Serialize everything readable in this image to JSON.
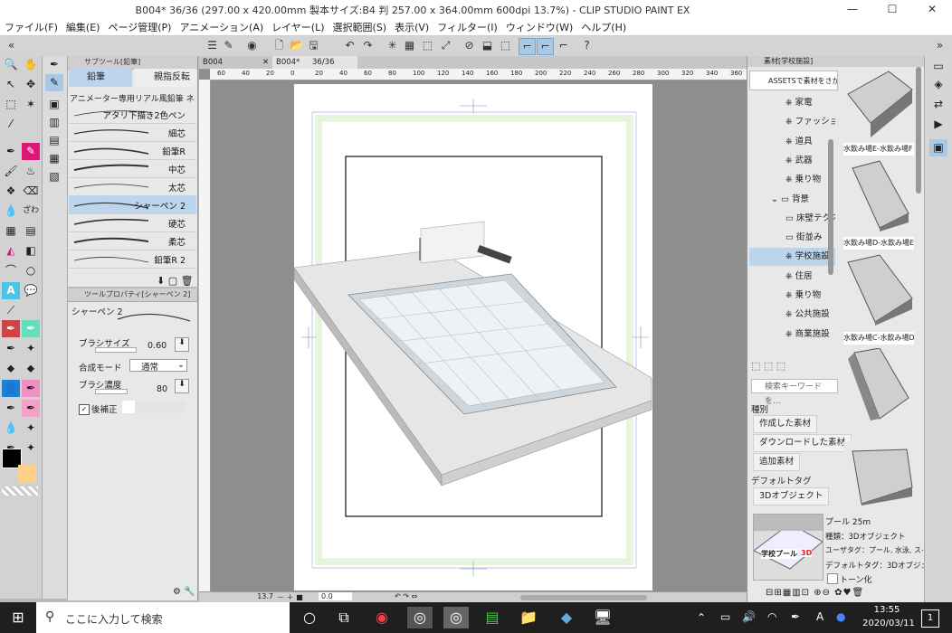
{
  "window": {
    "title": "B004* 36/36 (297.00 x 420.00mm 製本サイズ:B4 判 257.00 x 364.00mm 600dpi 13.7%) - CLIP STUDIO PAINT EX",
    "minimize": "—",
    "maximize": "☐",
    "close": "✕"
  },
  "menu": [
    "ファイル(F)",
    "編集(E)",
    "ページ管理(P)",
    "アニメーション(A)",
    "レイヤー(L)",
    "選択範囲(S)",
    "表示(V)",
    "フィルター(I)",
    "ウィンドウ(W)",
    "ヘルプ(H)"
  ],
  "subtool_panel": {
    "title": "サブツール[鉛筆]",
    "tab_pencil": "鉛筆",
    "tab_other": "親指反転",
    "group_name": "アニメーター専用リアル風鉛筆 ネ",
    "brushes": [
      "アタリ下描き2色ペン",
      "細芯",
      "鉛筆R",
      "中芯",
      "太芯",
      "シャーペン 2",
      "硬芯",
      "柔芯",
      "鉛筆R 2"
    ],
    "selected_brush": "シャーペン 2"
  },
  "tool_property": {
    "title": "ツールプロパティ[シャーペン 2]",
    "preview_name": "シャーペン 2",
    "brush_size_label": "ブラシサイズ",
    "brush_size_value": "0.60",
    "blend_mode_label": "合成モード",
    "blend_mode_value": "通常",
    "density_label": "ブラシ濃度",
    "density_value": "80",
    "stabilization_label": "後補正"
  },
  "canvas": {
    "tab_1": "B004",
    "tab_2": "B004*",
    "tab_2_page": "36/36",
    "ruler_ticks": [
      "60",
      "40",
      "20",
      "0",
      "20",
      "40",
      "60",
      "80",
      "100",
      "120",
      "140",
      "160",
      "180",
      "200",
      "220",
      "240",
      "260",
      "280",
      "300",
      "320",
      "340",
      "360"
    ],
    "zoom": "13.7",
    "angle": "0.0"
  },
  "material_panel": {
    "title": "素材[学校施設]",
    "assets_button": "ASSETSで素材をさがす",
    "tree": [
      "家電",
      "ファッション",
      "道具",
      "武器",
      "乗り物",
      "背景",
      "床壁テクスチャ",
      "街並み",
      "学校施設",
      "住居",
      "乗り物",
      "公共施設",
      "商業施設"
    ],
    "selected_tree": "学校施設",
    "search_placeholder": "検索キーワードを...",
    "filter_heading": "種別",
    "filters": [
      "作成した素材",
      "ダウンロードした素材",
      "追加素材"
    ],
    "default_tag_heading": "デフォルトタグ",
    "default_tag": "3Dオブジェクト",
    "thumb_captions": [
      "水飲み場E-水飲み場F",
      "水飲み場D-水飲み場E",
      "水飲み場C-水飲み場D"
    ],
    "detail": {
      "name": "プール 25m",
      "type": "種類：3Dオブジェクト",
      "user_tags": "ユーザタグ：プール, 水泳, スイミング",
      "default_tag": "デフォルトタグ：3Dオブジェクト",
      "tone_label": "トーン化",
      "thumb_label": "学校プール",
      "thumb_label_3d": "3D"
    }
  },
  "taskbar": {
    "search_placeholder": "ここに入力して検索",
    "ime": "A",
    "time": "13:55",
    "date": "2020/03/11",
    "notification_count": "1"
  },
  "colors": {
    "selection": "#bcd4ec",
    "accent_magenta": "#e0157a",
    "skin": "#ffd08a",
    "taskbar": "#1f1f1f"
  }
}
